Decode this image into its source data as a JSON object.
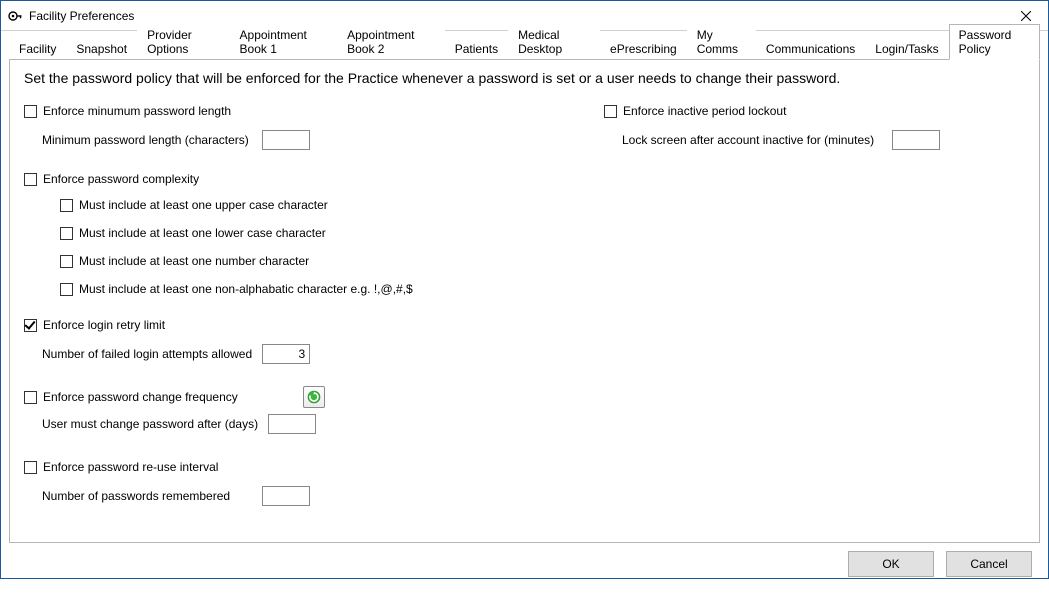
{
  "window": {
    "title": "Facility Preferences"
  },
  "tabs": [
    {
      "label": "Facility"
    },
    {
      "label": "Snapshot"
    },
    {
      "label": "Provider Options"
    },
    {
      "label": "Appointment Book 1"
    },
    {
      "label": "Appointment Book 2"
    },
    {
      "label": "Patients"
    },
    {
      "label": "Medical Desktop"
    },
    {
      "label": "ePrescribing"
    },
    {
      "label": "My Comms"
    },
    {
      "label": "Communications"
    },
    {
      "label": "Login/Tasks"
    },
    {
      "label": "Password Policy"
    }
  ],
  "active_tab": 11,
  "intro": "Set the password policy that will be enforced for the Practice whenever a password is set or a user needs to change their password.",
  "left": {
    "min_length": {
      "checkbox_label": "Enforce minumum password length",
      "checked": false,
      "field_label": "Minimum password length (characters)",
      "value": ""
    },
    "complexity": {
      "checkbox_label": "Enforce password complexity",
      "checked": false,
      "rules": [
        {
          "label": "Must include at least one upper case character",
          "checked": false
        },
        {
          "label": "Must include at least one lower case character",
          "checked": false
        },
        {
          "label": "Must include at least one number character",
          "checked": false
        },
        {
          "label": "Must include at least one non-alphabatic character e.g. !,@,#,$",
          "checked": false
        }
      ]
    },
    "retry": {
      "checkbox_label": "Enforce login retry limit",
      "checked": true,
      "field_label": "Number of failed login attempts allowed",
      "value": "3"
    },
    "change_freq": {
      "checkbox_label": "Enforce password change frequency",
      "checked": false,
      "field_label": "User must change password after (days)",
      "value": ""
    },
    "reuse": {
      "checkbox_label": "Enforce password re-use interval",
      "checked": false,
      "field_label": "Number of passwords remembered",
      "value": ""
    }
  },
  "right": {
    "inactive": {
      "checkbox_label": "Enforce inactive period lockout",
      "checked": false,
      "field_label": "Lock screen after account inactive for (minutes)",
      "value": ""
    }
  },
  "buttons": {
    "ok": "OK",
    "cancel": "Cancel"
  }
}
